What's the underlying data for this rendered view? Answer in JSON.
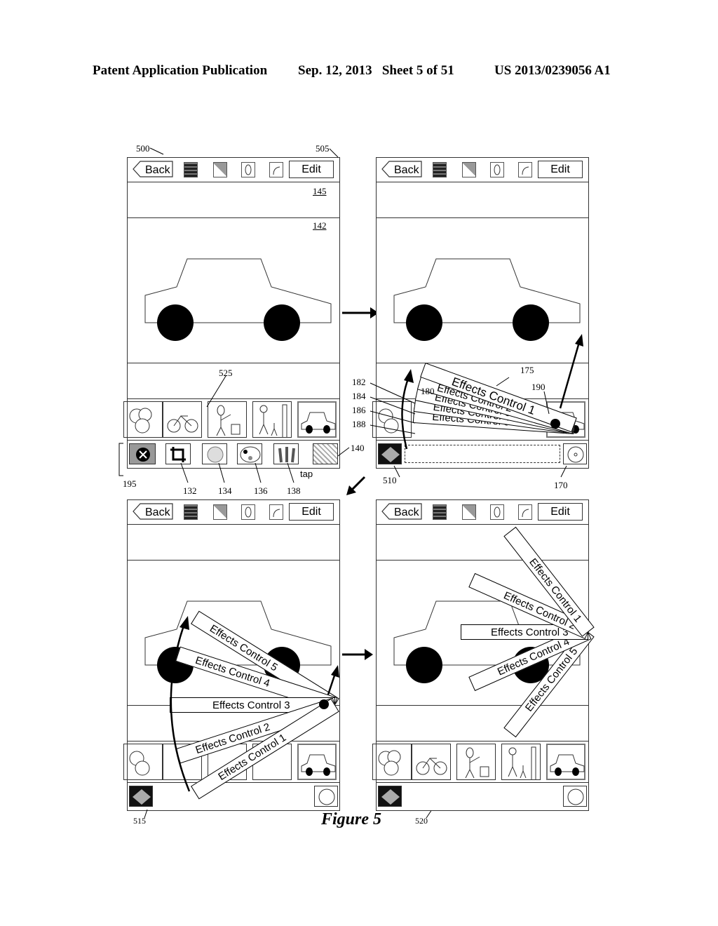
{
  "header": {
    "left": "Patent Application Publication",
    "middle": "Sep. 12, 2013   Sheet 5 of 51",
    "right": "US 2013/0239056 A1"
  },
  "figure_caption": "Figure 5",
  "toolbar": {
    "back_label": "Back",
    "edit_label": "Edit"
  },
  "tap_label": "tap",
  "effects_controls": [
    "Effects Control 1",
    "Effects Control 2",
    "Effects Control 3",
    "Effects Control 4",
    "Effects Control 5"
  ],
  "refs": {
    "r500": "500",
    "r505": "505",
    "r145": "145",
    "r142": "142",
    "r525": "525",
    "r140": "140",
    "r195": "195",
    "r132": "132",
    "r134": "134",
    "r136": "136",
    "r138": "138",
    "r175": "175",
    "r180": "180",
    "r182": "182",
    "r184": "184",
    "r186": "186",
    "r188": "188",
    "r190": "190",
    "r510": "510",
    "r170": "170",
    "r515": "515",
    "r520": "520"
  },
  "thumbnails": [
    "clouds",
    "bicycle",
    "person-with-camera",
    "family-with-building",
    "car"
  ],
  "tools": [
    "cancel",
    "crop",
    "exposure",
    "color-palette",
    "brushes",
    "effects"
  ]
}
